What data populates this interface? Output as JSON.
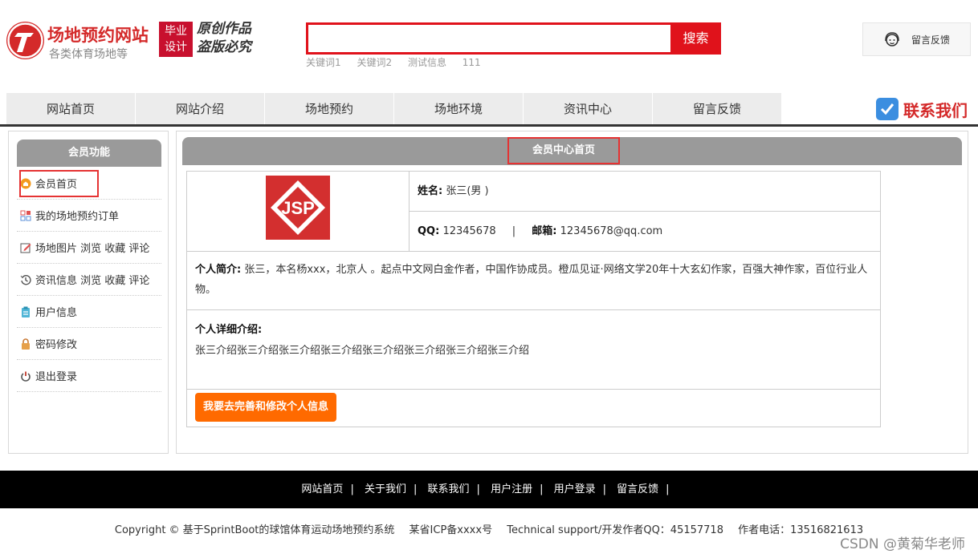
{
  "header": {
    "site_title": "场地预约网站",
    "site_subtitle": "各类体育场地等",
    "badge_line1": "毕业",
    "badge_line2": "设计",
    "original_line1": "原创作品",
    "original_line2": "盗版必究",
    "search_value": "",
    "search_button": "搜索",
    "keywords": [
      "关键词1",
      "关键词2",
      "测试信息",
      "111"
    ],
    "feedback_label": "留言反馈"
  },
  "nav": {
    "items": [
      "网站首页",
      "网站介绍",
      "场地预约",
      "场地环境",
      "资讯中心",
      "留言反馈"
    ],
    "contact_label": "联系我们"
  },
  "sidebar": {
    "title": "会员功能",
    "items": [
      {
        "label": "会员首页",
        "icon": "home-icon"
      },
      {
        "label": "我的场地预约订单",
        "icon": "grid-icon"
      },
      {
        "label": "场地图片 浏览 收藏 评论",
        "icon": "edit-icon"
      },
      {
        "label": "资讯信息 浏览 收藏 评论",
        "icon": "history-icon"
      },
      {
        "label": "用户信息",
        "icon": "clipboard-icon"
      },
      {
        "label": "密码修改",
        "icon": "lock-icon"
      },
      {
        "label": "退出登录",
        "icon": "power-icon"
      }
    ]
  },
  "main": {
    "title": "会员中心首页",
    "avatar_text": "JSP",
    "name_label": "姓名:",
    "name_value": "张三(男 )",
    "qq_label": "QQ:",
    "qq_value": "12345678",
    "divider": "|",
    "email_label": "邮箱:",
    "email_value": "12345678@qq.com",
    "bio_label": "个人简介:",
    "bio_text": "张三，本名杨xxx，北京人 。起点中文网白金作者，中国作协成员。橙瓜见证·网络文学20年十大玄幻作家，百强大神作家，百位行业人物。",
    "detail_label": "个人详细介绍:",
    "detail_text": "张三介绍张三介绍张三介绍张三介绍张三介绍张三介绍张三介绍张三介绍",
    "edit_button": "我要去完善和修改个人信息"
  },
  "footer": {
    "links": [
      "网站首页",
      "关于我们",
      "联系我们",
      "用户注册",
      "用户登录",
      "留言反馈"
    ],
    "link_sep": "|",
    "copyright": "Copyright © 基于SprintBoot的球馆体育运动场地预约系统",
    "icp": "某省ICP备xxxx号",
    "support": "Technical support/开发作者QQ：45157718",
    "phone": "作者电话：13516821613",
    "watermark": "CSDN @黄菊华老师"
  },
  "colors": {
    "brand_red": "#d42a2a",
    "search_red": "#e0121b",
    "header_gray": "#9a9a9a",
    "button_orange": "#ff6a00",
    "highlight_border": "#e53333"
  }
}
